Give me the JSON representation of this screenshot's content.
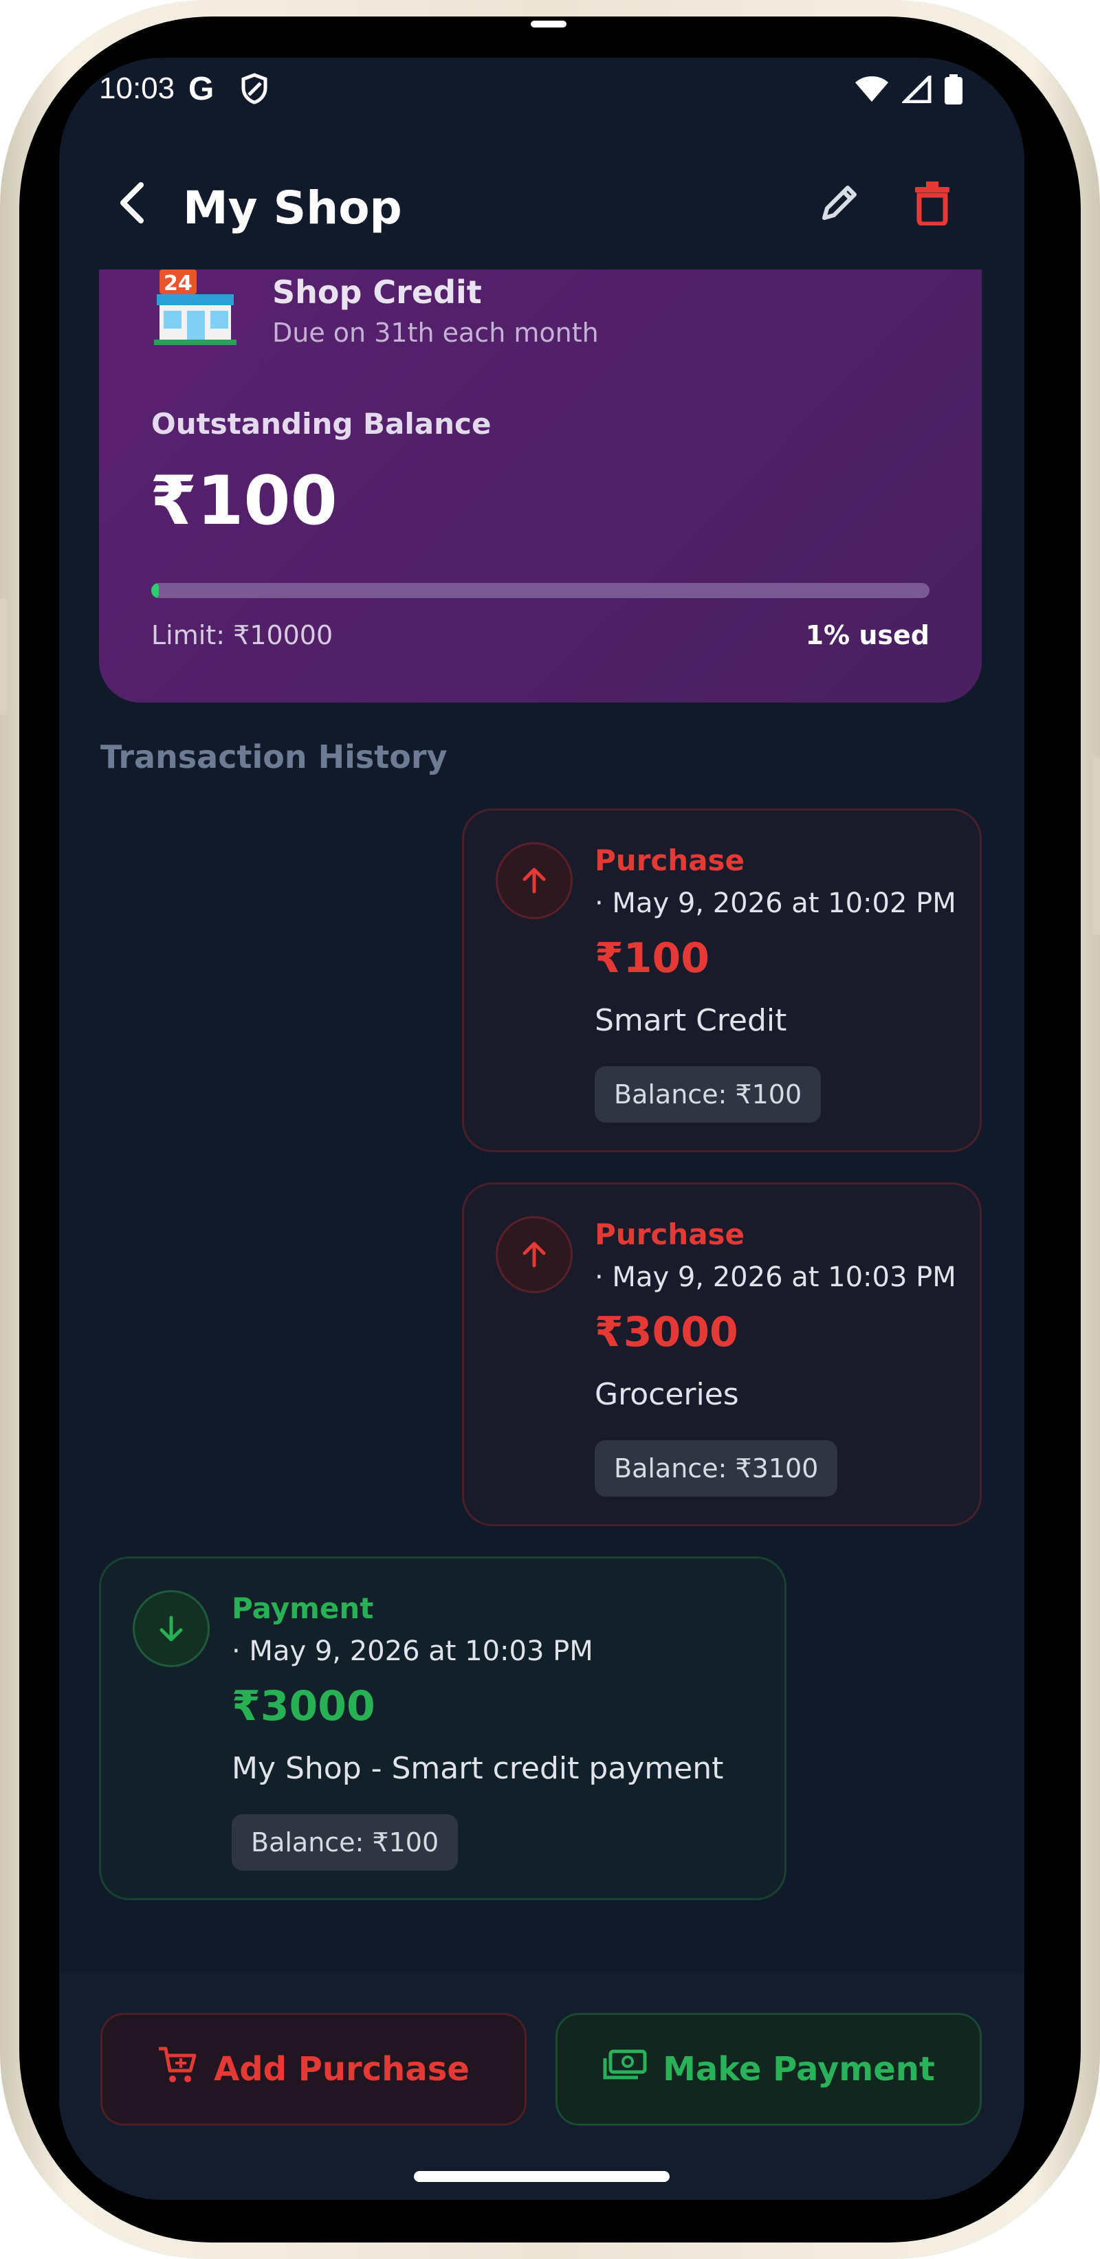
{
  "status_bar": {
    "time": "10:03",
    "google_letter": "G",
    "icons": [
      "shield-icon",
      "wifi-icon",
      "signal-icon",
      "battery-icon"
    ]
  },
  "app_bar": {
    "title": "My Shop",
    "icons": [
      "back-arrow-icon",
      "edit-pencil-icon",
      "delete-trash-icon"
    ]
  },
  "credit_card": {
    "shop_icon": "store-24-icon",
    "shop_name": "Shop Credit",
    "due_text": "Due on 31th each month",
    "outstanding_label": "Outstanding Balance",
    "outstanding_amount": "₹100",
    "limit_text": "Limit: ₹10000",
    "used_text": "1% used",
    "used_fraction": 0.01
  },
  "section_title": "Transaction History",
  "transactions": [
    {
      "type": "Purchase",
      "date": "· May 9, 2026 at 10:02 PM",
      "amount": "₹100",
      "description": "Smart Credit",
      "balance": "Balance: ₹100",
      "icon": "arrow-up-icon"
    },
    {
      "type": "Purchase",
      "date": "· May 9, 2026 at 10:03 PM",
      "amount": "₹3000",
      "description": "Groceries",
      "balance": "Balance: ₹3100",
      "icon": "arrow-up-icon"
    },
    {
      "type": "Payment",
      "date": "· May 9, 2026 at 10:03 PM",
      "amount": "₹3000",
      "description": "My Shop - Smart credit payment",
      "balance": "Balance: ₹100",
      "icon": "arrow-down-icon"
    }
  ],
  "actions": {
    "add_purchase": "Add Purchase",
    "make_payment": "Make Payment"
  },
  "colors": {
    "background": "#111a2b",
    "card_purple": "#4e2066",
    "purchase_red": "#e53935",
    "payment_green": "#27b154",
    "progress_green": "#2ecc71"
  }
}
